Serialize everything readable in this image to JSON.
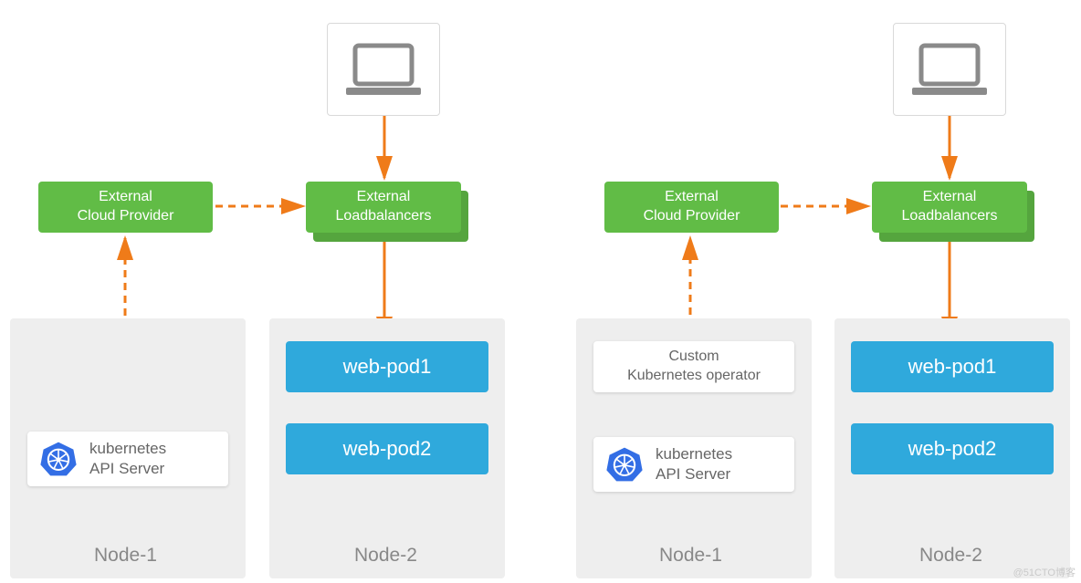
{
  "left": {
    "cloud_provider": "External\nCloud Provider",
    "loadbalancers": "External\nLoadbalancers",
    "api_server": "kubernetes\nAPI Server",
    "pod1": "web-pod1",
    "pod2": "web-pod2",
    "node1": "Node-1",
    "node2": "Node-2"
  },
  "right": {
    "cloud_provider": "External\nCloud Provider",
    "loadbalancers": "External\nLoadbalancers",
    "operator": "Custom\nKubernetes operator",
    "api_server": "kubernetes\nAPI Server",
    "pod1": "web-pod1",
    "pod2": "web-pod2",
    "node1": "Node-1",
    "node2": "Node-2"
  },
  "watermark": "@51CTO博客"
}
